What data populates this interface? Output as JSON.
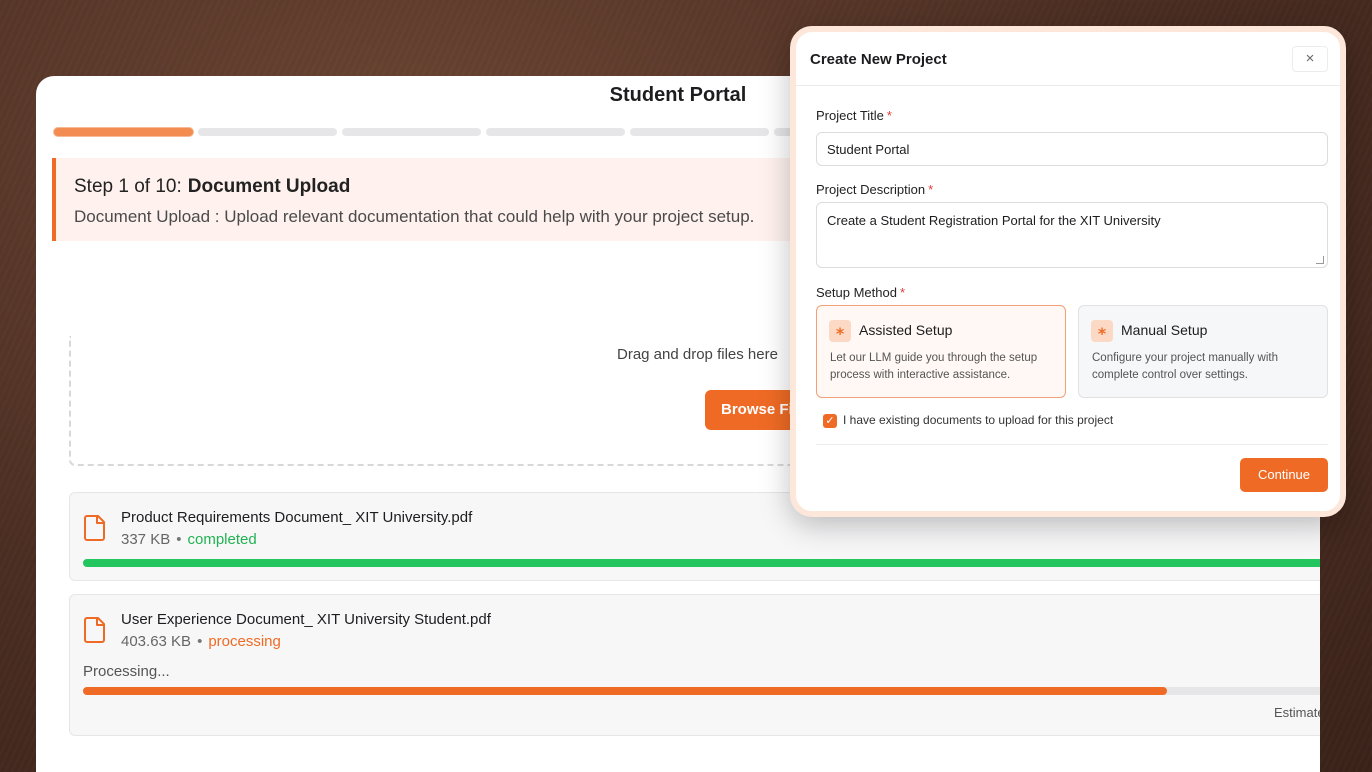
{
  "main": {
    "title": "Student Portal",
    "stepper": {
      "total": 10,
      "current": 1
    },
    "step": {
      "heading_num": "Step 1 of 10:",
      "heading_name": "Document Upload",
      "description": "Document Upload : Upload relevant documentation that could help with your project setup."
    },
    "dropzone": {
      "text": "Drag and drop files here",
      "browse_label": "Browse Files"
    },
    "files": [
      {
        "name": "Product Requirements Document_ XIT University.pdf",
        "size": "337 KB",
        "status": "completed",
        "progress": 1.0
      },
      {
        "name": "User Experience Document_ XIT University Student.pdf",
        "size": "403.63 KB",
        "status": "processing",
        "processing_label": "Processing...",
        "progress": 0.86,
        "estimate_label": "Estimated"
      }
    ]
  },
  "modal": {
    "title": "Create New Project",
    "close_glyph": "×",
    "project_title_label": "Project Title",
    "project_title_value": "Student Portal",
    "project_description_label": "Project Description",
    "project_description_value": "Create a Student Registration Portal for the XIT University",
    "setup_method_label": "Setup Method",
    "required_mark": "*",
    "options": [
      {
        "title": "Assisted Setup",
        "description": "Let our LLM guide you through the setup process with interactive assistance.",
        "selected": true,
        "icon": "sparkle-icon"
      },
      {
        "title": "Manual Setup",
        "description": "Configure your project manually with complete control over settings.",
        "selected": false,
        "icon": "sparkle-icon"
      }
    ],
    "existing_docs_label": "I have existing documents to upload for this project",
    "existing_docs_checked": true,
    "continue_label": "Continue"
  },
  "colors": {
    "accent": "#ef6b25",
    "success": "#22c55e"
  }
}
